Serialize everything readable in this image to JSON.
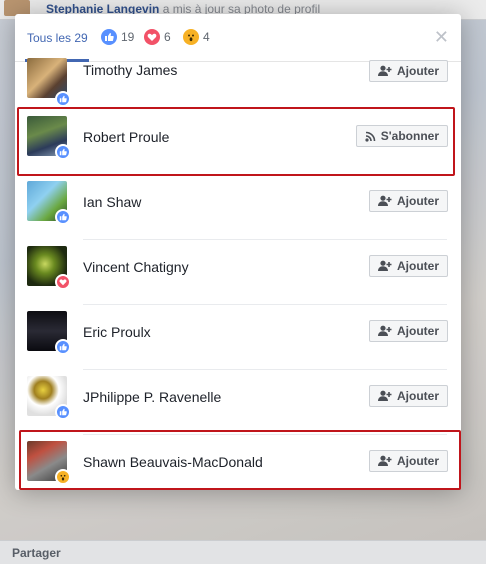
{
  "background": {
    "post_author": "Stephanie Langevin",
    "post_text": " a mis à jour sa photo de profil",
    "share_label": "Partager"
  },
  "modal": {
    "tab_all_label": "Tous les 29",
    "reactions": [
      {
        "type": "like",
        "icon": "like-icon",
        "count": "19",
        "color": "#5890ff"
      },
      {
        "type": "love",
        "icon": "love-icon",
        "count": "6",
        "color": "#f25268"
      },
      {
        "type": "wow",
        "icon": "wow-icon",
        "count": "4",
        "color": "#f7b125"
      }
    ],
    "close_icon": "close-icon",
    "people": [
      {
        "name": "Timothy James",
        "reaction": "like",
        "button": "Ajouter",
        "button_icon": "add-friend-icon"
      },
      {
        "name": "Robert Proule",
        "reaction": "like",
        "button": "S'abonner",
        "button_icon": "rss-icon"
      },
      {
        "name": "Ian Shaw",
        "reaction": "like",
        "button": "Ajouter",
        "button_icon": "add-friend-icon"
      },
      {
        "name": "Vincent Chatigny",
        "reaction": "love",
        "button": "Ajouter",
        "button_icon": "add-friend-icon"
      },
      {
        "name": "Eric Proulx",
        "reaction": "like",
        "button": "Ajouter",
        "button_icon": "add-friend-icon"
      },
      {
        "name": "JPhilippe P. Ravenelle",
        "reaction": "like",
        "button": "Ajouter",
        "button_icon": "add-friend-icon"
      },
      {
        "name": "Shawn Beauvais-MacDonald",
        "reaction": "wow",
        "button": "Ajouter",
        "button_icon": "add-friend-icon"
      }
    ],
    "highlight_color": "#c0151b"
  }
}
